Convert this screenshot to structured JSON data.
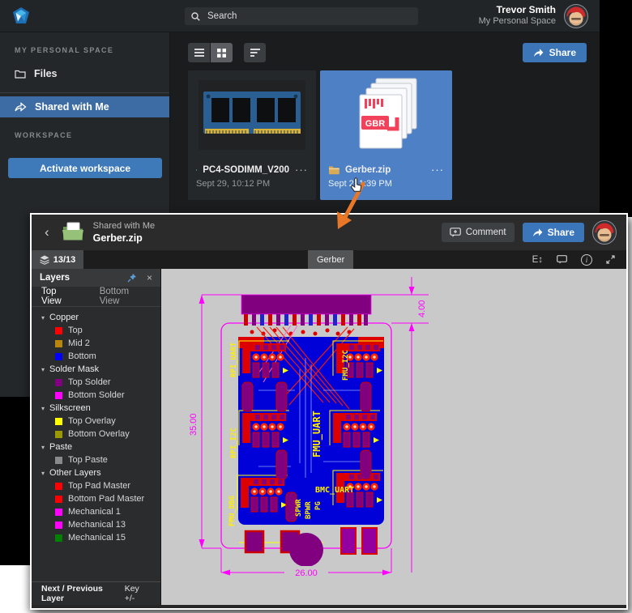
{
  "app": {
    "topbar": {
      "search_placeholder": "Search",
      "user_name": "Trevor Smith",
      "user_space": "My Personal Space"
    },
    "sidebar": {
      "section_personal": "MY PERSONAL SPACE",
      "files_label": "Files",
      "shared_label": "Shared with Me",
      "section_workspace": "WORKSPACE",
      "activate_label": "Activate workspace"
    },
    "toolbar": {
      "share_label": "Share"
    },
    "cards": [
      {
        "name": "PC4-SODIMM_V200",
        "date": "Sept 29, 10:12 PM"
      },
      {
        "name": "Gerber.zip",
        "date": "Sept 2, 1:39 PM",
        "badge": "GBR"
      }
    ]
  },
  "viewer": {
    "header": {
      "breadcrumb": "Shared with Me",
      "title": "Gerber.zip",
      "comment_label": "Comment",
      "share_label": "Share"
    },
    "tabs": {
      "layers_count": "13/13",
      "doc_tab": "Gerber"
    },
    "panel": {
      "title": "Layers",
      "view_tabs": [
        "Top View",
        "Bottom View"
      ],
      "groups": [
        {
          "name": "Copper",
          "layers": [
            {
              "label": "Top",
              "color": "#ff0000"
            },
            {
              "label": "Mid 2",
              "color": "#b8860b"
            },
            {
              "label": "Bottom",
              "color": "#0000ff"
            }
          ]
        },
        {
          "name": "Solder Mask",
          "layers": [
            {
              "label": "Top Solder",
              "color": "#800080"
            },
            {
              "label": "Bottom Solder",
              "color": "#ff00ff"
            }
          ]
        },
        {
          "name": "Silkscreen",
          "layers": [
            {
              "label": "Top Overlay",
              "color": "#ffff00"
            },
            {
              "label": "Bottom Overlay",
              "color": "#9a9a00"
            }
          ]
        },
        {
          "name": "Paste",
          "layers": [
            {
              "label": "Top Paste",
              "color": "#8a8a8a"
            }
          ]
        },
        {
          "name": "Other Layers",
          "layers": [
            {
              "label": "Top Pad Master",
              "color": "#ff0000"
            },
            {
              "label": "Bottom Pad Master",
              "color": "#ff0000"
            },
            {
              "label": "Mechanical 1",
              "color": "#ff00ff"
            },
            {
              "label": "Mechanical 13",
              "color": "#ff00ff"
            },
            {
              "label": "Mechanical 15",
              "color": "#008000"
            }
          ]
        }
      ],
      "footer": {
        "left": "Next / Previous Layer",
        "right": "Key +/-"
      }
    },
    "pcb": {
      "dim_height": "35.00",
      "dim_width": "26.00",
      "dim_top": "4.00",
      "labels": {
        "rpi_uart": "RPI_UART",
        "rpi_i2c": "RPI_I2C",
        "fmu_dbg": "FMU_DBG",
        "fmu_uart": "FMU_UART",
        "spwr": "SPWR",
        "bpwr": "BPWR",
        "pg": "PG",
        "bmc_uart": "BMC_UART",
        "fmu_i2c": "FMU_I2C"
      }
    }
  },
  "icons": {
    "back": "‹",
    "close": "×",
    "more": "···",
    "measure": "E↕",
    "info": "i"
  },
  "colors": {
    "accent_blue": "#3c76b7",
    "selected_card": "#4d80c4",
    "sidebar_active": "#3d6ba3",
    "annotation_arrow": "#e87728",
    "canvas_gray": "#c9c9c9"
  }
}
